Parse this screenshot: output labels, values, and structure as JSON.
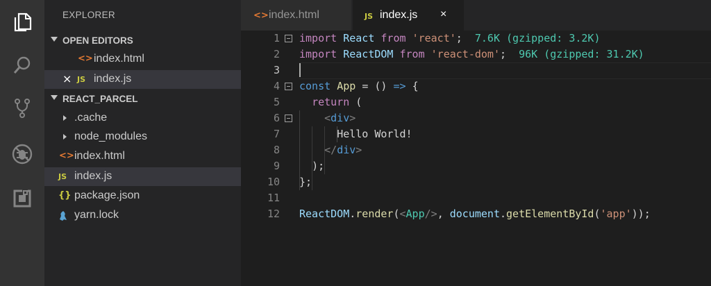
{
  "explorer": {
    "title": "EXPLORER",
    "open_editors": {
      "label": "OPEN EDITORS",
      "items": [
        {
          "name": "index.html",
          "icon": "<>"
        },
        {
          "name": "index.js",
          "icon": "JS",
          "close": "×"
        }
      ]
    },
    "project": {
      "label": "REACT_PARCEL",
      "items": [
        {
          "name": ".cache",
          "type": "folder"
        },
        {
          "name": "node_modules",
          "type": "folder"
        },
        {
          "name": "index.html",
          "icon": "<>"
        },
        {
          "name": "index.js",
          "icon": "JS"
        },
        {
          "name": "package.json",
          "icon": "{}"
        },
        {
          "name": "yarn.lock",
          "icon": "yarn-icon"
        }
      ]
    }
  },
  "tabs": [
    {
      "label": "index.html",
      "icon": "<>"
    },
    {
      "label": "index.js",
      "icon": "JS",
      "close": "×"
    }
  ],
  "editor": {
    "line_numbers": [
      "1",
      "2",
      "3",
      "4",
      "5",
      "6",
      "7",
      "8",
      "9",
      "10",
      "11",
      "12"
    ],
    "lines": {
      "l1": {
        "kw1": "import",
        "id": "React",
        "kw2": "from",
        "str": "'react'",
        "semi": ";",
        "size": "7.6K (gzipped: 3.2K)"
      },
      "l2": {
        "kw1": "import",
        "id": "ReactDOM",
        "kw2": "from",
        "str": "'react-dom'",
        "semi": ";",
        "size": "96K (gzipped: 31.2K)"
      },
      "l4": {
        "kw": "const",
        "id": "App",
        "rest": "= ()",
        "arrow": "=>",
        "brace": "{"
      },
      "l5": {
        "kw": "return",
        "paren": "("
      },
      "l6": {
        "open": "<",
        "tag": "div",
        "close": ">"
      },
      "l7": {
        "text": "Hello World!"
      },
      "l8": {
        "open": "</",
        "tag": "div",
        "close": ">"
      },
      "l9": {
        "text": ");"
      },
      "l10": {
        "text": "};"
      },
      "l12": {
        "obj": "ReactDOM",
        "dot": ".",
        "fn": "render",
        "p1": "(",
        "lt": "<",
        "cls": "App",
        "sc": "/>",
        "comma": ",",
        "doc": "document",
        "dot2": ".",
        "fn2": "getElementById",
        "p2": "(",
        "str": "'app'",
        "end": "));"
      }
    }
  },
  "colors": {
    "accent": "#4ec9b0",
    "keyword": "#c586c0",
    "string": "#ce9178",
    "js_icon": "#cbcb41",
    "html_icon": "#e37933"
  }
}
